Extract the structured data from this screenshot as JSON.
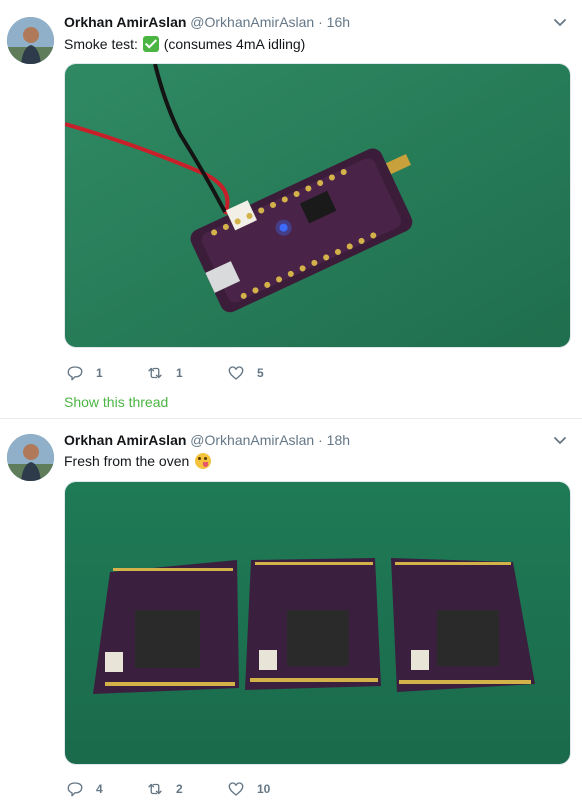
{
  "tweets": [
    {
      "author_name": "Orkhan AmirAslan",
      "author_handle": "@OrkhanAmirAslan",
      "separator": "·",
      "time": "16h",
      "text_before": "Smoke test:",
      "text_emoji": "check-mark-emoji",
      "text_after": "(consumes 4mA idling)",
      "media": "photo of a purple feather-style PCB with LED lit, connected to red/black battery wire on green cutting mat",
      "replies": "1",
      "retweets": "1",
      "likes": "5",
      "show_thread": "Show this thread"
    },
    {
      "author_name": "Orkhan AmirAslan",
      "author_handle": "@OrkhanAmirAslan",
      "separator": "·",
      "time": "18h",
      "text_before": "Fresh from the oven",
      "text_emoji": "face-savoring-food-emoji",
      "media": "photo of three small purple TinyLoRa PCBs on green cutting mat",
      "replies": "4",
      "retweets": "2",
      "likes": "10"
    }
  ],
  "colors": {
    "text": "#14171a",
    "secondary": "#657786",
    "link_green": "#4bb543",
    "divider": "#e6ecf0"
  }
}
